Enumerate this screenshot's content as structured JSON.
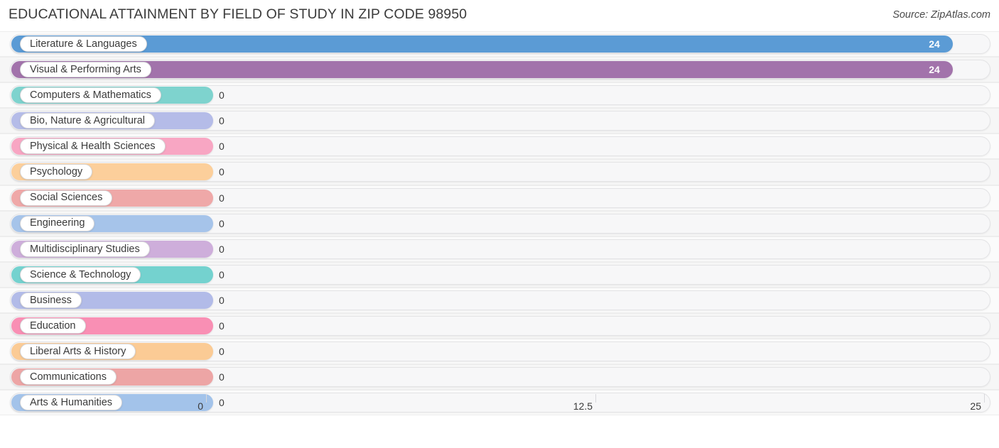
{
  "header": {
    "title": "EDUCATIONAL ATTAINMENT BY FIELD OF STUDY IN ZIP CODE 98950",
    "source": "Source: ZipAtlas.com"
  },
  "chart_data": {
    "type": "bar",
    "orientation": "horizontal",
    "title": "EDUCATIONAL ATTAINMENT BY FIELD OF STUDY IN ZIP CODE 98950",
    "subtitle": "",
    "xlabel": "",
    "ylabel": "",
    "xlim": [
      0,
      25
    ],
    "grid": true,
    "legend": "none",
    "xticks": [
      "0",
      "12.5",
      "25"
    ],
    "xtick_values": [
      0,
      12.5,
      25
    ],
    "categories": [
      "Literature & Languages",
      "Visual & Performing Arts",
      "Computers & Mathematics",
      "Bio, Nature & Agricultural",
      "Physical & Health Sciences",
      "Psychology",
      "Social Sciences",
      "Engineering",
      "Multidisciplinary Studies",
      "Science & Technology",
      "Business",
      "Education",
      "Liberal Arts & History",
      "Communications",
      "Arts & Humanities"
    ],
    "values": [
      24,
      24,
      0,
      0,
      0,
      0,
      0,
      0,
      0,
      0,
      0,
      0,
      0,
      0,
      0
    ],
    "value_labels": [
      "24",
      "24",
      "0",
      "0",
      "0",
      "0",
      "0",
      "0",
      "0",
      "0",
      "0",
      "0",
      "0",
      "0",
      "0"
    ],
    "colors": [
      "#5b9bd5",
      "#a273ab",
      "#7ed3ce",
      "#b5bce8",
      "#f8a6c3",
      "#fccf9b",
      "#efa8a8",
      "#a6c4ea",
      "#ceaedb",
      "#74d2cf",
      "#b2bbe8",
      "#f98fb4",
      "#fbcb95",
      "#eda5a5",
      "#a3c3ea"
    ]
  }
}
